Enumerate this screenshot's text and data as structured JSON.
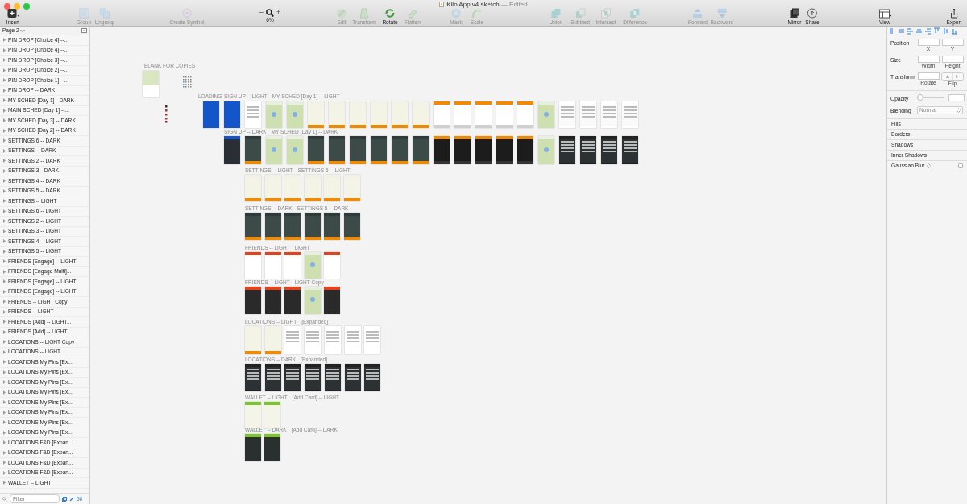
{
  "window": {
    "title": "Kilo App v4.sketch",
    "edited": "— Edited"
  },
  "toolbar": [
    {
      "label": "Insert",
      "disabled": false
    },
    {
      "label": "Group",
      "disabled": true
    },
    {
      "label": "Ungroup",
      "disabled": true
    },
    {
      "label": "Create Symbol",
      "disabled": true
    },
    {
      "label": "Edit",
      "disabled": true
    },
    {
      "label": "Transform",
      "disabled": true
    },
    {
      "label": "Rotate",
      "disabled": false
    },
    {
      "label": "Flatten",
      "disabled": true
    },
    {
      "label": "Mask",
      "disabled": true
    },
    {
      "label": "Scale",
      "disabled": true
    },
    {
      "label": "Union",
      "disabled": true
    },
    {
      "label": "Subtract",
      "disabled": true
    },
    {
      "label": "Intersect",
      "disabled": true
    },
    {
      "label": "Difference",
      "disabled": true
    },
    {
      "label": "Forward",
      "disabled": true
    },
    {
      "label": "Backward",
      "disabled": true
    },
    {
      "label": "Mirror",
      "disabled": false
    },
    {
      "label": "Share",
      "disabled": false
    },
    {
      "label": "View",
      "disabled": false
    },
    {
      "label": "Export",
      "disabled": false
    }
  ],
  "zoom": {
    "minus": "–",
    "plus": "+",
    "value": "6%"
  },
  "sidebar": {
    "page": "Page 2",
    "layers": [
      {
        "name": "PIN DROP [Choice 4] --..."
      },
      {
        "name": "PIN DROP [Choice 4] --..."
      },
      {
        "name": "PIN DROP [Choice 3] --..."
      },
      {
        "name": "PIN DROP [Choice 2] --..."
      },
      {
        "name": "PIN DROP [Choice 1] --..."
      },
      {
        "name": "PIN DROP -- DARK"
      },
      {
        "name": "MY SCHED [Day 1] --DARK"
      },
      {
        "name": "MAIN SCHED [Day 1] --..."
      },
      {
        "name": "MY SCHED [Day 3] -- DARK"
      },
      {
        "name": "MY SCHED [Day 2] -- DARK"
      },
      {
        "name": "SETTINGS 6 -- DARK"
      },
      {
        "name": "SETTINGS -- DARK"
      },
      {
        "name": "SETTINGS 2 -- DARK"
      },
      {
        "name": "SETTINGS 3 --DARK"
      },
      {
        "name": "SETTINGS 4 -- DARK"
      },
      {
        "name": "SETTINGS 5 -- DARK"
      },
      {
        "name": "SETTINGS -- LIGHT"
      },
      {
        "name": "SETTINGS 6 -- LIGHT"
      },
      {
        "name": "SETTINGS 2 -- LIGHT"
      },
      {
        "name": "SETTINGS 3 -- LIGHT"
      },
      {
        "name": "SETTINGS 4 -- LIGHT"
      },
      {
        "name": "SETTINGS 5 -- LIGHT"
      },
      {
        "name": "FRIENDS [Engage] -- LIGHT"
      },
      {
        "name": "FRIENDS [Engage Multi]..."
      },
      {
        "name": "FRIENDS [Engage] -- LIGHT"
      },
      {
        "name": "FRIENDS [Engage] -- LIGHT"
      },
      {
        "name": "FRIENDS -- LIGHT Copy"
      },
      {
        "name": "FRIENDS -- LIGHT"
      },
      {
        "name": "FRIENDS [Add] -- LIGHT..."
      },
      {
        "name": "FRIENDS [Add] -- LIGHT"
      },
      {
        "name": "LOCATIONS -- LIGHT Copy"
      },
      {
        "name": "LOCATIONS -- LIGHT"
      },
      {
        "name": "LOCATIONS My Pins [Ex..."
      },
      {
        "name": "LOCATIONS My Pins [Ex..."
      },
      {
        "name": "LOCATIONS My Pins [Ex..."
      },
      {
        "name": "LOCATIONS My Pins [Ex..."
      },
      {
        "name": "LOCATIONS My Pins [Ex..."
      },
      {
        "name": "LOCATIONS My Pins [Ex..."
      },
      {
        "name": "LOCATIONS My Pins [Ex..."
      },
      {
        "name": "LOCATIONS My Pins [Ex..."
      },
      {
        "name": "LOCATIONS F&D [Expan..."
      },
      {
        "name": "LOCATIONS F&D [Expan..."
      },
      {
        "name": "LOCATIONS F&D [Expan..."
      },
      {
        "name": "LOCATIONS F&D [Expan..."
      },
      {
        "name": "WALLET -- LIGHT"
      }
    ],
    "filter_placeholder": "Filter",
    "count": "56"
  },
  "canvas": {
    "blank": {
      "label": "BLANK FOR COPIES"
    },
    "loading": {
      "label": "LOADING",
      "artboard": {
        "kind": "blue"
      }
    },
    "rows": [
      {
        "label": "SIGN UP -- LIGHT",
        "tail": "MY SCHED [Day 1] -- LIGHT",
        "artboards": [
          {
            "kind": "blue"
          },
          {
            "kind": "white"
          },
          {
            "kind": "map"
          },
          {
            "kind": "map"
          },
          {
            "kind": "beige"
          },
          {
            "kind": "beige"
          },
          {
            "kind": "beige"
          },
          {
            "kind": "beige"
          },
          {
            "kind": "beige"
          },
          {
            "kind": "beige"
          },
          {
            "kind": "form"
          },
          {
            "kind": "form"
          },
          {
            "kind": "form"
          },
          {
            "kind": "form"
          },
          {
            "kind": "form"
          },
          {
            "kind": "map"
          },
          {
            "kind": "list"
          },
          {
            "kind": "list"
          },
          {
            "kind": "list"
          },
          {
            "kind": "list"
          }
        ]
      },
      {
        "label": "SIGN UP -- DARK",
        "tail": "MY SCHED [Day 1] -- DARK",
        "artboards": [
          {
            "kind": "bluedark"
          },
          {
            "kind": "dark"
          },
          {
            "kind": "map"
          },
          {
            "kind": "map"
          },
          {
            "kind": "dark"
          },
          {
            "kind": "dark"
          },
          {
            "kind": "dark"
          },
          {
            "kind": "dark"
          },
          {
            "kind": "dark"
          },
          {
            "kind": "dark"
          },
          {
            "kind": "black"
          },
          {
            "kind": "black"
          },
          {
            "kind": "black"
          },
          {
            "kind": "black"
          },
          {
            "kind": "black"
          },
          {
            "kind": "map"
          },
          {
            "kind": "darklist"
          },
          {
            "kind": "darklist"
          },
          {
            "kind": "darklist"
          },
          {
            "kind": "darklist"
          }
        ]
      },
      {
        "label": "SETTINGS -- LIGHT",
        "tail": "SETTINGS 5 -- LIGHT",
        "artboards": [
          {
            "kind": "beige"
          },
          {
            "kind": "beige"
          },
          {
            "kind": "beige"
          },
          {
            "kind": "beige"
          },
          {
            "kind": "beige"
          },
          {
            "kind": "beige"
          }
        ]
      },
      {
        "label": "SETTINGS -- DARK",
        "tail": "SETTINGS 5 -- DARK",
        "artboards": [
          {
            "kind": "dark"
          },
          {
            "kind": "dark"
          },
          {
            "kind": "dark"
          },
          {
            "kind": "dark"
          },
          {
            "kind": "dark"
          },
          {
            "kind": "dark"
          }
        ]
      },
      {
        "label": "FRIENDS -- LIGHT",
        "tail": "LIGHT",
        "artboards": [
          {
            "kind": "red"
          },
          {
            "kind": "red"
          },
          {
            "kind": "red"
          },
          {
            "kind": "map"
          },
          {
            "kind": "red"
          }
        ]
      },
      {
        "label": "FRIENDS -- LIGHT",
        "tail": "LIGHT Copy",
        "artboards": [
          {
            "kind": "reddark"
          },
          {
            "kind": "reddark"
          },
          {
            "kind": "reddark"
          },
          {
            "kind": "map"
          },
          {
            "kind": "reddark"
          }
        ]
      },
      {
        "label": "LOCATIONS -- LIGHT",
        "tail": "[Expanded]",
        "artboards": [
          {
            "kind": "beige"
          },
          {
            "kind": "beige"
          },
          {
            "kind": "white"
          },
          {
            "kind": "white"
          },
          {
            "kind": "white"
          },
          {
            "kind": "white"
          },
          {
            "kind": "white"
          }
        ]
      },
      {
        "label": "LOCATIONS -- DARK",
        "tail": "[Expanded]",
        "artboards": [
          {
            "kind": "darklist"
          },
          {
            "kind": "darklist"
          },
          {
            "kind": "darklist"
          },
          {
            "kind": "darklist"
          },
          {
            "kind": "darklist"
          },
          {
            "kind": "darklist"
          },
          {
            "kind": "darklist"
          }
        ]
      },
      {
        "label": "WALLET -- LIGHT",
        "tail": "[Add Card] -- LIGHT",
        "artboards": [
          {
            "kind": "green"
          },
          {
            "kind": "green"
          }
        ]
      },
      {
        "label": "WALLET -- DARK",
        "tail": "[Add Card] -- DARK",
        "artboards": [
          {
            "kind": "greendark"
          },
          {
            "kind": "greendark"
          }
        ]
      }
    ]
  },
  "inspector": {
    "position": {
      "label": "Position",
      "captions": [
        "X",
        "Y"
      ]
    },
    "size": {
      "label": "Size",
      "captions": [
        "Width",
        "Height"
      ]
    },
    "transform": {
      "label": "Transform",
      "captions": [
        "Rotate",
        "Flip"
      ]
    },
    "opacity": {
      "label": "Opacity",
      "level": 0
    },
    "blending": {
      "label": "Blending",
      "value": "Normal"
    },
    "sections": [
      {
        "label": "Fills"
      },
      {
        "label": "Borders"
      },
      {
        "label": "Shadows"
      },
      {
        "label": "Inner Shadows"
      },
      {
        "label": "Gaussian Blur",
        "kind": "toggle",
        "checked": false
      }
    ]
  }
}
